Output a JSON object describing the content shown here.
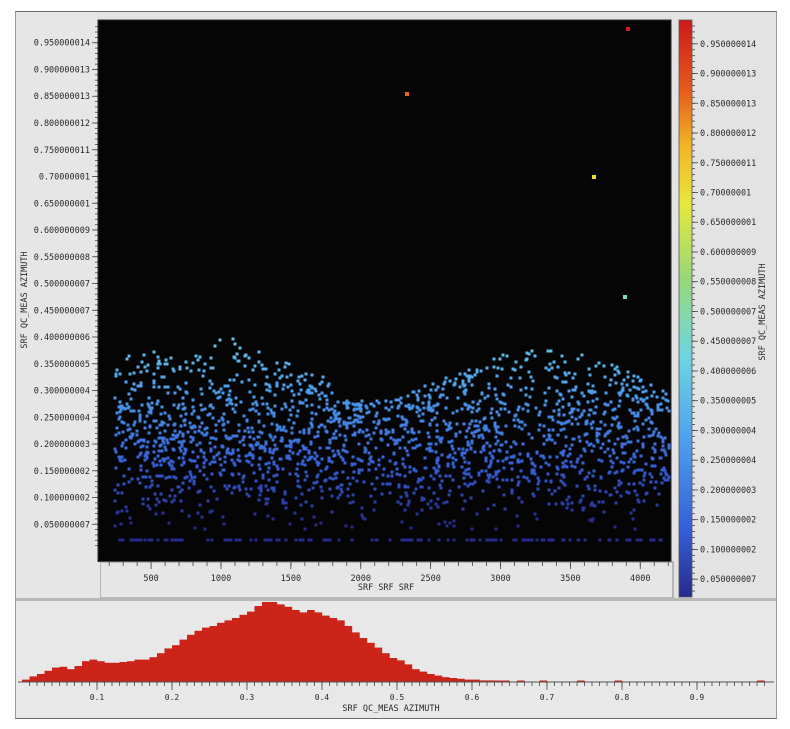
{
  "scatter_panel": {
    "x_axis_label": "SRF SRF SRF",
    "y_axis_label": "SRF QC_MEAS AZIMUTH",
    "colorbar_label": "SRF QC_MEAS AZIMUTH",
    "x_tick_labels": [
      "500",
      "1000",
      "1500",
      "2000",
      "2500",
      "3000",
      "3500",
      "4000"
    ],
    "y_tick_labels": [
      "0.950000014",
      "0.900000013",
      "0.850000013",
      "0.800000012",
      "0.750000011",
      "0.70000001",
      "0.650000001",
      "0.600000009",
      "0.550000008",
      "0.500000007",
      "0.450000007",
      "0.400000006",
      "0.350000005",
      "0.300000004",
      "0.250000004",
      "0.200000003",
      "0.150000002",
      "0.100000002",
      "0.050000007"
    ],
    "colorbar_tick_labels": [
      "0.950000014",
      "0.900000013",
      "0.850000013",
      "0.800000012",
      "0.750000011",
      "0.70000001",
      "0.650000001",
      "0.600000009",
      "0.550000008",
      "0.500000007",
      "0.450000007",
      "0.400000006",
      "0.350000005",
      "0.300000004",
      "0.250000004",
      "0.200000003",
      "0.150000002",
      "0.100000002",
      "0.050000007"
    ],
    "background_color": "#050505"
  },
  "histogram_panel": {
    "x_axis_label": "SRF QC_MEAS AZIMUTH",
    "x_tick_labels": [
      "0.1",
      "0.2",
      "0.3",
      "0.4",
      "0.5",
      "0.6",
      "0.7",
      "0.8",
      "0.9"
    ],
    "bar_color": "#cc2418"
  },
  "chart_data": [
    {
      "type": "scatter",
      "xlabel": "SRF SRF SRF",
      "ylabel": "SRF QC_MEAS AZIMUTH",
      "xlim": [
        120,
        4220
      ],
      "ylim": [
        0,
        1.0
      ],
      "grid": false,
      "colormap": "jet",
      "color_range": [
        0.05,
        0.98
      ],
      "point_cloud": {
        "x_range": [
          240,
          4210
        ],
        "y_mode": 0.2,
        "y_range": [
          0.04,
          0.42
        ],
        "gap_near_x": 2150,
        "approx_points": 3200
      },
      "outliers": [
        {
          "x": 3910,
          "y": 0.975
        },
        {
          "x": 2330,
          "y": 0.855
        },
        {
          "x": 3670,
          "y": 0.7
        },
        {
          "x": 3890,
          "y": 0.475
        }
      ]
    },
    {
      "type": "bar",
      "xlabel": "SRF QC_MEAS AZIMUTH",
      "xlim": [
        0,
        1.0
      ],
      "bin_width": 0.01,
      "bin_start": 0.0,
      "values_relative": [
        0.03,
        0.07,
        0.1,
        0.14,
        0.18,
        0.19,
        0.16,
        0.2,
        0.26,
        0.28,
        0.26,
        0.24,
        0.24,
        0.25,
        0.26,
        0.28,
        0.28,
        0.31,
        0.36,
        0.42,
        0.46,
        0.53,
        0.59,
        0.64,
        0.68,
        0.7,
        0.74,
        0.77,
        0.8,
        0.84,
        0.88,
        0.95,
        1.0,
        1.0,
        0.97,
        0.94,
        0.9,
        0.87,
        0.9,
        0.87,
        0.83,
        0.8,
        0.77,
        0.7,
        0.62,
        0.55,
        0.49,
        0.43,
        0.36,
        0.3,
        0.27,
        0.22,
        0.16,
        0.13,
        0.1,
        0.08,
        0.06,
        0.05,
        0.04,
        0.03,
        0.03,
        0.02,
        0.02,
        0.01,
        0.01,
        0.0,
        0.01,
        0.0,
        0.0,
        0.01,
        0.0,
        0.0,
        0.0,
        0.0,
        0.01,
        0.0,
        0.0,
        0.0,
        0.0,
        0.01,
        0.0,
        0.0,
        0.0,
        0.0,
        0.0,
        0.0,
        0.0,
        0.0,
        0.0,
        0.0,
        0.0,
        0.0,
        0.0,
        0.0,
        0.0,
        0.0,
        0.0,
        0.0,
        0.01,
        0.0
      ]
    }
  ]
}
